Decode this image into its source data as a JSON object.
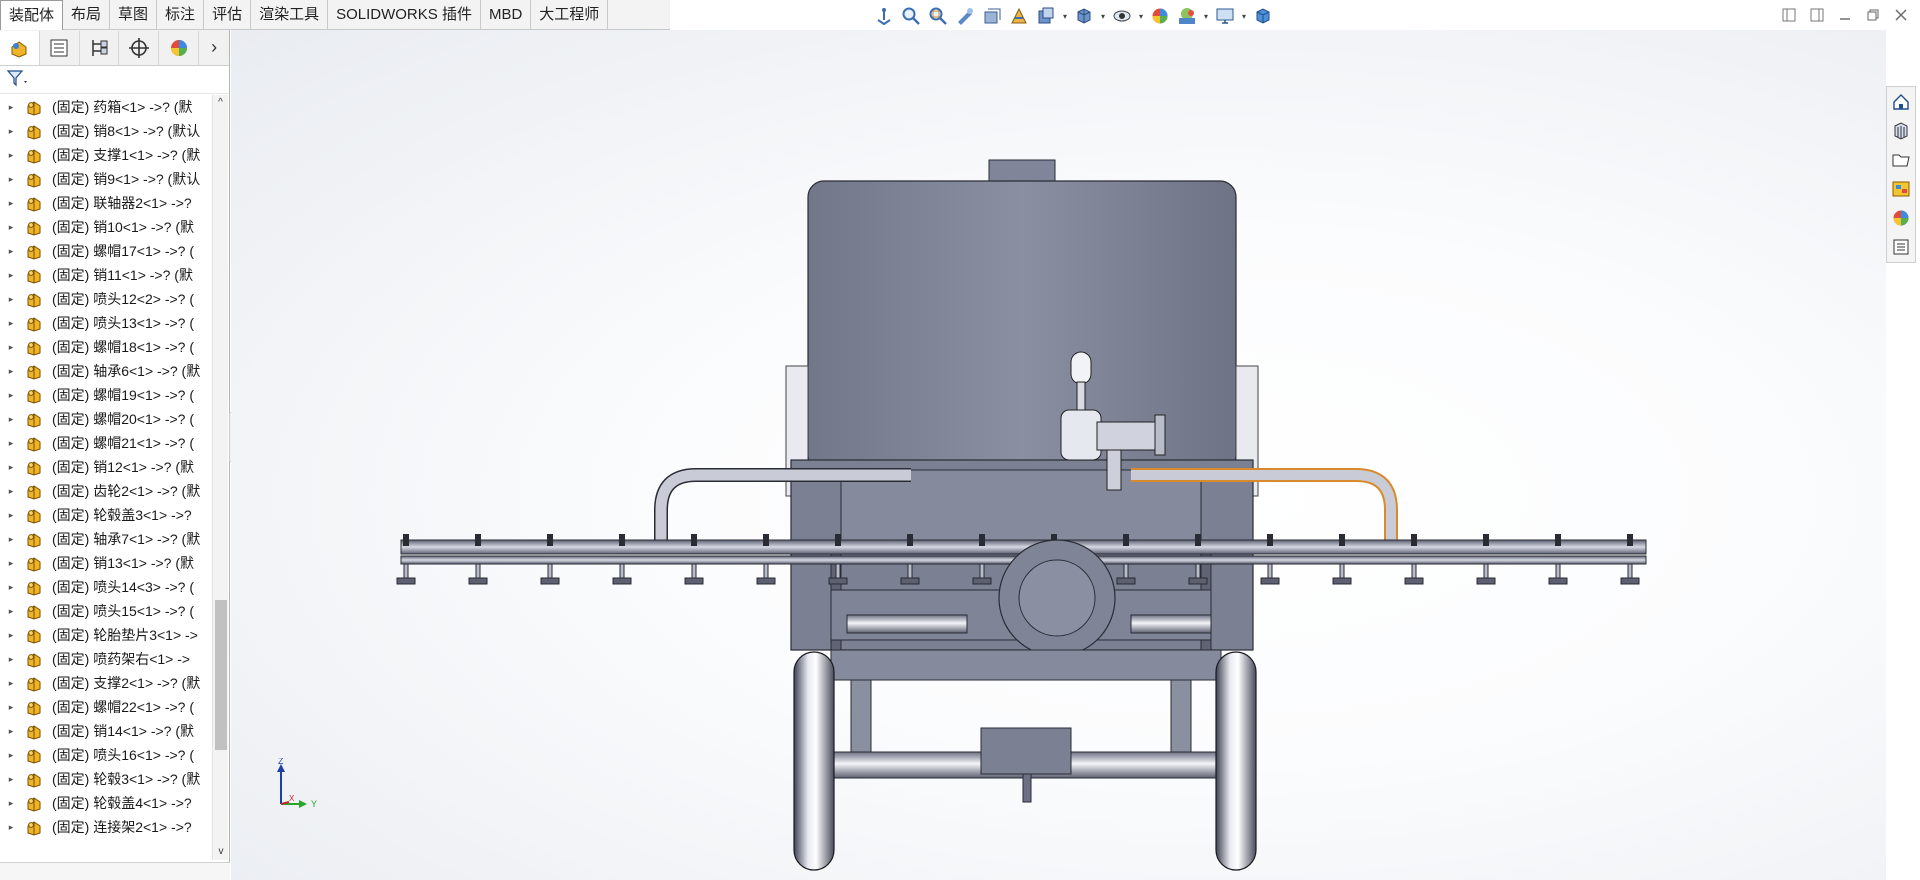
{
  "ribbon": {
    "tabs": [
      "装配体",
      "布局",
      "草图",
      "标注",
      "评估",
      "渲染工具",
      "SOLIDWORKS 插件",
      "MBD",
      "大工程师"
    ],
    "active_tab": "装配体"
  },
  "heads_up_toolbar": {
    "icons": [
      "view-orientation-icon",
      "zoom-to-fit-icon",
      "zoom-to-area-icon",
      "previous-view-icon",
      "section-view-icon",
      "dynamic-annotation-icon",
      "view-setting-icon",
      "display-style-icon",
      "hide-show-icon",
      "edit-appearance-icon",
      "apply-scene-icon",
      "view-settings-monitor-icon",
      "3d-view-icon"
    ]
  },
  "feature_tree": {
    "panel_tabs": [
      "feature-manager-icon",
      "property-manager-icon",
      "configuration-manager-icon",
      "dimxpert-icon",
      "display-manager-icon"
    ],
    "items": [
      {
        "label": "(固定) 药箱<1> ->? (默"
      },
      {
        "label": "(固定) 销8<1> ->? (默认"
      },
      {
        "label": "(固定) 支撑1<1> ->? (默"
      },
      {
        "label": "(固定) 销9<1> ->? (默认"
      },
      {
        "label": "(固定) 联轴器2<1> ->?"
      },
      {
        "label": "(固定) 销10<1> ->? (默"
      },
      {
        "label": "(固定) 螺帽17<1> ->? ("
      },
      {
        "label": "(固定) 销11<1> ->? (默"
      },
      {
        "label": "(固定) 喷头12<2> ->? ("
      },
      {
        "label": "(固定) 喷头13<1> ->? ("
      },
      {
        "label": "(固定) 螺帽18<1> ->? ("
      },
      {
        "label": "(固定) 轴承6<1> ->? (默"
      },
      {
        "label": "(固定) 螺帽19<1> ->? ("
      },
      {
        "label": "(固定) 螺帽20<1> ->? ("
      },
      {
        "label": "(固定) 螺帽21<1> ->? ("
      },
      {
        "label": "(固定) 销12<1> ->? (默"
      },
      {
        "label": "(固定) 齿轮2<1> ->? (默"
      },
      {
        "label": "(固定) 轮毂盖3<1> ->?"
      },
      {
        "label": "(固定) 轴承7<1> ->? (默"
      },
      {
        "label": "(固定) 销13<1> ->? (默"
      },
      {
        "label": "(固定) 喷头14<3> ->? ("
      },
      {
        "label": "(固定) 喷头15<1> ->? ("
      },
      {
        "label": "(固定) 轮胎垫片3<1> ->"
      },
      {
        "label": "(固定) 喷药架右<1> ->"
      },
      {
        "label": "(固定) 支撑2<1> ->? (默"
      },
      {
        "label": "(固定) 螺帽22<1> ->? ("
      },
      {
        "label": "(固定) 销14<1> ->? (默"
      },
      {
        "label": "(固定) 喷头16<1> ->? ("
      },
      {
        "label": "(固定) 轮毂3<1> ->? (默"
      },
      {
        "label": "(固定) 轮毂盖4<1> ->?"
      },
      {
        "label": "(固定) 连接架2<1> ->?"
      }
    ]
  },
  "triad": {
    "z": "Z",
    "x": "X",
    "y": "Y"
  },
  "task_pane": {
    "icons": [
      "solidworks-resources-icon",
      "design-library-icon",
      "file-explorer-icon",
      "view-palette-icon",
      "appearances-scenes-icon",
      "custom-properties-icon"
    ]
  },
  "colors": {
    "model_body": "#7d8294",
    "model_dark": "#5d6172",
    "model_edge": "#2a2c35",
    "highlight": "#d98a2b",
    "tab_active": "#ffffff",
    "folder_yellow": "#f0b429"
  }
}
